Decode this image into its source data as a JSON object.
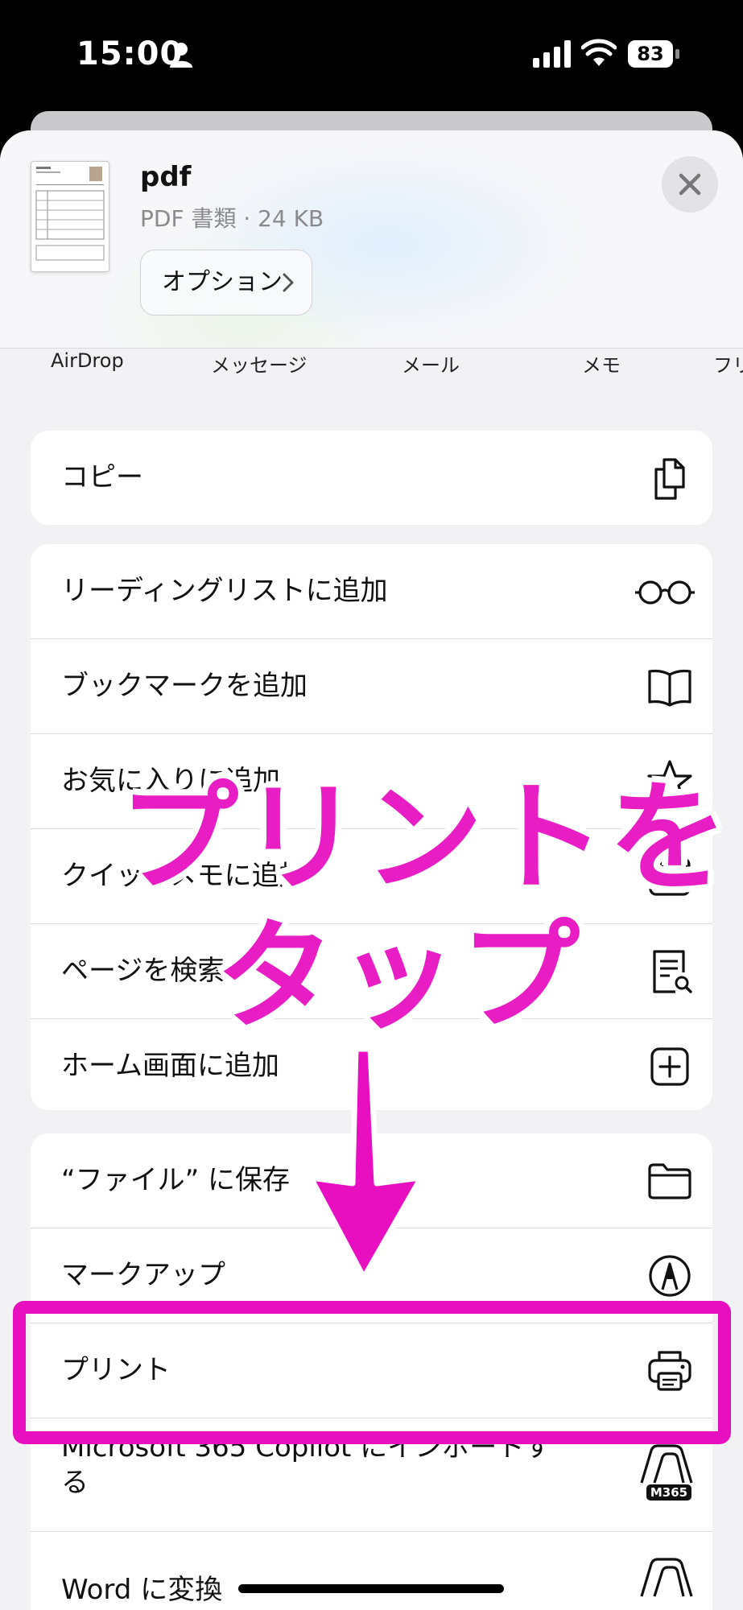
{
  "status_bar": {
    "time": "15:00",
    "battery": "83"
  },
  "header": {
    "title": "pdf",
    "meta": "PDF 書類 · 24 KB",
    "options_label": "オプション"
  },
  "apps": [
    "AirDrop",
    "メッセージ",
    "メール",
    "メモ",
    "フリ"
  ],
  "group1": [
    {
      "label": "コピー",
      "icon": "copy-icon"
    }
  ],
  "group2": [
    {
      "label": "リーディングリストに追加",
      "icon": "glasses-icon"
    },
    {
      "label": "ブックマークを追加",
      "icon": "book-icon"
    },
    {
      "label": "お気に入りに追加",
      "icon": "star-icon"
    },
    {
      "label": "クイックメモに追加",
      "icon": "quick-note-icon"
    },
    {
      "label": "ページを検索",
      "icon": "find-in-page-icon"
    },
    {
      "label": "ホーム画面に追加",
      "icon": "add-square-icon"
    }
  ],
  "group3": [
    {
      "label": "“ファイル” に保存",
      "icon": "folder-icon"
    },
    {
      "label": "マークアップ",
      "icon": "markup-icon"
    },
    {
      "label": "プリント",
      "icon": "printer-icon"
    },
    {
      "label": "Microsoft 365 Copilot にインポートする",
      "icon": "m365-icon"
    },
    {
      "label": "Word に変換",
      "icon": "m365-icon"
    }
  ],
  "annotation": {
    "line1": "プリントを",
    "line2": "タップ",
    "color": "#e81ec4"
  }
}
